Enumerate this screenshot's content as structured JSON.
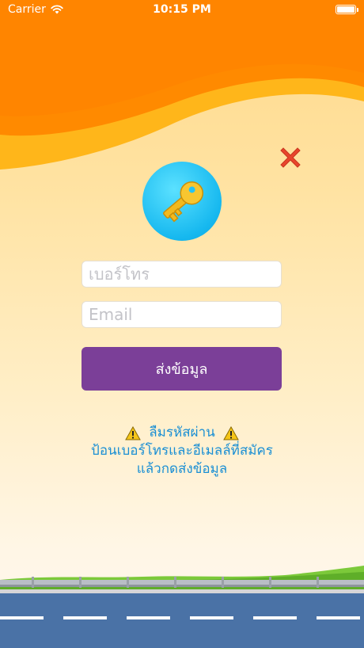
{
  "status_bar": {
    "carrier": "Carrier",
    "time": "10:15 PM",
    "battery_level": 1.0
  },
  "form": {
    "phone_placeholder": "เบอร์โทร",
    "email_placeholder": "Email",
    "submit_label": "ส่งข้อมูล"
  },
  "message": {
    "title": "ลืมรหัสผ่าน",
    "line1": "ป้อนเบอร์โทรและอีเมลล์ที่สมัคร",
    "line2": "แล้วกดส่งข้อมูล"
  },
  "icons": {
    "close": "close-icon",
    "key": "key-icon",
    "warning": "warning-icon",
    "wifi": "wifi-icon",
    "battery": "battery-icon"
  },
  "colors": {
    "header_orange": "#ff8a00",
    "wave_amber": "#ffc21a",
    "button_purple": "#7b3f98",
    "message_blue": "#1a8fd4",
    "close_red": "#e8452c",
    "road_blue": "#4a72a6",
    "grass_green": "#7cc93a"
  }
}
